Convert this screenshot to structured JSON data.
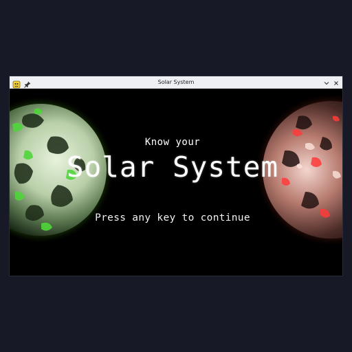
{
  "window": {
    "title": "Solar System",
    "controls": {
      "minimize_icon": "chevron-down-icon",
      "close_icon": "close-icon",
      "pin_icon": "pin-icon",
      "app_icon": "pygame-snake-icon"
    }
  },
  "splash": {
    "subtitle": "Know your",
    "title": "Solar System",
    "prompt": "Press any key to continue"
  },
  "colors": {
    "desktop_background": "#171a26",
    "titlebar_background": "#eef0f3",
    "content_background": "#000000",
    "text": "#ffffff",
    "left_planet_glow": "#8dff3a",
    "right_planet_glow": "#ff5a4a"
  }
}
